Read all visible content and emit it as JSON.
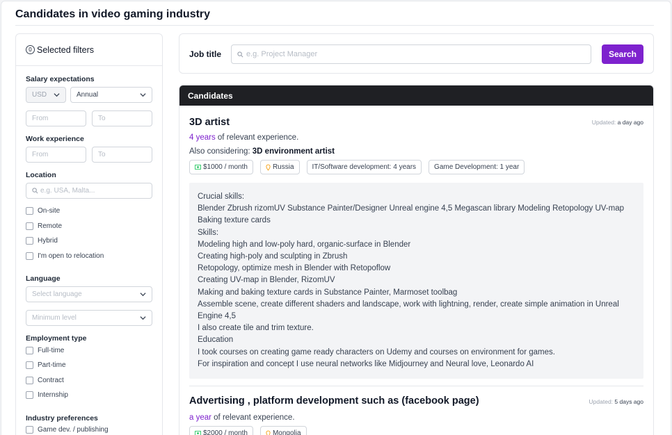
{
  "page_title": "Candidates in video gaming industry",
  "sidebar": {
    "filters_count": "0",
    "filters_label": "Selected filters",
    "salary": {
      "title": "Salary expectations",
      "currency": "USD",
      "period": "Annual",
      "from_placeholder": "From",
      "to_placeholder": "To"
    },
    "experience": {
      "title": "Work experience",
      "from_placeholder": "From",
      "to_placeholder": "To"
    },
    "location": {
      "title": "Location",
      "placeholder": "e.g. USA, Malta...",
      "options": [
        "On-site",
        "Remote",
        "Hybrid",
        "I'm open to relocation"
      ]
    },
    "language": {
      "title": "Language",
      "language_placeholder": "Select language",
      "level_placeholder": "Minimum level"
    },
    "employment": {
      "title": "Employment type",
      "options": [
        "Full-time",
        "Part-time",
        "Contract",
        "Internship"
      ]
    },
    "industry": {
      "title": "Industry preferences",
      "options": [
        "Game dev. / publishing"
      ]
    }
  },
  "search": {
    "label": "Job title",
    "placeholder": "e.g. Project Manager",
    "button": "Search"
  },
  "candidates": {
    "header": "Candidates",
    "items": [
      {
        "title": "3D artist",
        "updated_label": "Updated:",
        "updated_value": "a day ago",
        "exp_highlight": "4 years",
        "exp_rest": " of relevant experience.",
        "also_label": "Also considering: ",
        "also_value": "3D environment artist",
        "tags": {
          "salary": "$1000 / month",
          "location": "Russia",
          "exp1": "IT/Software development: 4 years",
          "exp2": "Game Development: 1 year"
        },
        "description": [
          "Crucial skills:",
          "Blender Zbrush rizomUV Substance Painter/Designer Unreal engine 4,5 Megascan library Modeling Retopology UV-map Baking texture cards",
          "Skills:",
          "Modeling high and low-poly hard, organic-surface in Blender",
          "Creating high-poly and sculpting in Zbrush",
          "Retopology, optimize mesh in Blender with Retopoflow",
          "Creating UV-map in Blender, RizomUV",
          "Making and baking texture cards in Substance Painter, Marmoset toolbag",
          "Assemble scene, create different shaders and landscape, work with lightning, render, create simple animation in Unreal Engine 4,5",
          "I also create tile and trim texture.",
          "Education",
          "I took courses on creating game ready characters on Udemy and courses on environment for games.",
          "For inspiration and concept I use neural networks like Midjourney and Neural love, Leonardo AI"
        ]
      },
      {
        "title": "Advertising , platform development such as (facebook page)",
        "updated_label": "Updated:",
        "updated_value": "5 days ago",
        "exp_highlight": "a year",
        "exp_rest": " of relevant experience.",
        "tags": {
          "salary": "$2000 / month",
          "location": "Mongolia"
        }
      }
    ]
  },
  "colors": {
    "accent": "#7e22ce",
    "header_bg": "#1f2024",
    "money_icon": "#22c55e",
    "pin_icon": "#f59e0b"
  }
}
